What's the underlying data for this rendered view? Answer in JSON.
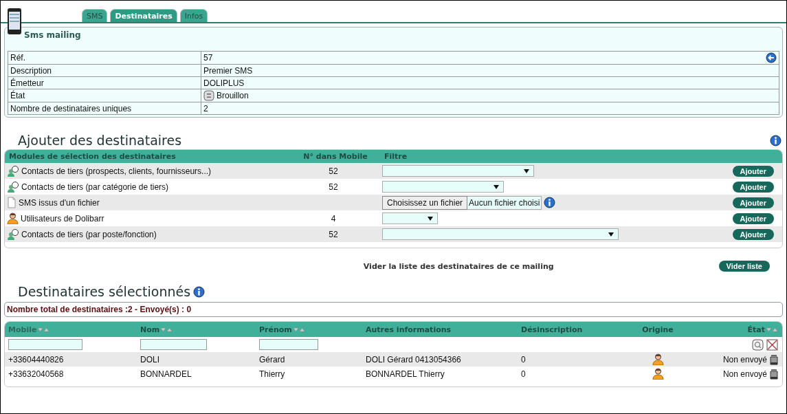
{
  "tabs": [
    {
      "label": "SMS",
      "selected": false
    },
    {
      "label": "Destinataires",
      "selected": true
    },
    {
      "label": "Infos",
      "selected": false
    }
  ],
  "card": {
    "title": "Sms mailing",
    "fields": [
      {
        "label": "Réf.",
        "value": "57",
        "kind": "back"
      },
      {
        "label": "Description",
        "value": "Premier SMS",
        "kind": "text"
      },
      {
        "label": "Émetteur",
        "value": "DOLIPLUS",
        "kind": "text"
      },
      {
        "label": "État",
        "value": "Brouillon",
        "kind": "status"
      },
      {
        "label": "Nombre de destinataires uniques",
        "value": "2",
        "kind": "text"
      }
    ]
  },
  "add_section": {
    "title": "Ajouter des destinataires",
    "columns": [
      "Modules de sélection des destinataires",
      "N° dans Mobile",
      "Filtre"
    ],
    "rows": [
      {
        "kind": "contact",
        "label": "Contacts de tiers (prospects, clients, fournisseurs...)",
        "count": "52",
        "filter": {
          "kind": "select"
        },
        "button": "Ajouter"
      },
      {
        "kind": "contact",
        "label": "Contacts de tiers (par catégorie de tiers)",
        "count": "52",
        "filter": {
          "kind": "select"
        },
        "button": "Ajouter"
      },
      {
        "kind": "file",
        "label": "SMS issus d'un fichier",
        "filter": {
          "kind": "file",
          "button": "Choisissez un fichier",
          "text": "Aucun fichier choisi"
        },
        "button": "Ajouter"
      },
      {
        "kind": "user",
        "label": "Utilisateurs de Dolibarr",
        "count": "4",
        "filter": {
          "kind": "select"
        },
        "button": "Ajouter"
      },
      {
        "kind": "contact",
        "label": "Contacts de tiers (par poste/fonction)",
        "count": "52",
        "filter": {
          "kind": "select"
        },
        "button": "Ajouter"
      }
    ],
    "clear": {
      "text": "Vider la liste des destinataires de ce mailing",
      "button": "Vider liste"
    }
  },
  "selected_section": {
    "title": "Destinataires sélectionnés",
    "summary": "Nombre total de destinataires :2 - Envoyé(s) : 0",
    "columns": [
      {
        "label": "Mobile",
        "sortable": true,
        "filter": true
      },
      {
        "label": "Nom",
        "sortable": true,
        "filter": true
      },
      {
        "label": "Prénom",
        "sortable": true,
        "filter": true
      },
      {
        "label": "Autres informations",
        "sortable": false,
        "filter": false
      },
      {
        "label": "Désinscription",
        "sortable": false,
        "filter": false
      },
      {
        "label": "Origine",
        "sortable": false,
        "filter": false
      },
      {
        "label": "État",
        "sortable": true,
        "filter": false
      }
    ],
    "rows": [
      {
        "mobile": "+33604440826",
        "nom": "DOLI",
        "prenom": "Gérard",
        "autres": "DOLI Gérard 0413054366",
        "desinscription": "0",
        "origin": {
          "kind": "user"
        },
        "etat": "Non envoyé"
      },
      {
        "mobile": "+33632040568",
        "nom": "BONNARDEL",
        "prenom": "Thierry",
        "autres": "BONNARDEL Thierry",
        "desinscription": "0",
        "origin": {
          "kind": "user"
        },
        "etat": "Non envoyé"
      }
    ]
  }
}
